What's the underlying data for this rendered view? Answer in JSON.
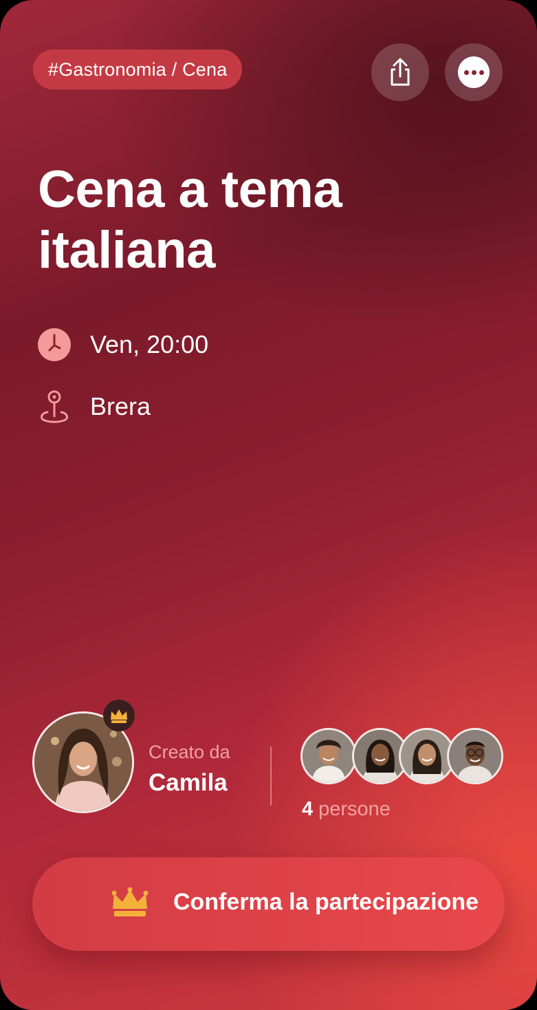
{
  "event": {
    "tag": "#Gastronomia / Cena",
    "title": "Cena a tema italiana",
    "time": "Ven, 20:00",
    "location": "Brera"
  },
  "actions": {
    "share_icon": "share-icon",
    "more_icon": "more-options-icon"
  },
  "creator": {
    "label": "Creato da",
    "name": "Camila",
    "badge_icon": "crown-icon"
  },
  "attendees": {
    "count": "4",
    "unit": "persone"
  },
  "cta": {
    "label": "Conferma la partecipazione",
    "icon": "crown-icon"
  },
  "colors": {
    "accent": "#e8484a",
    "crown": "#f3b13c",
    "icon_pink": "#f59a9a"
  }
}
